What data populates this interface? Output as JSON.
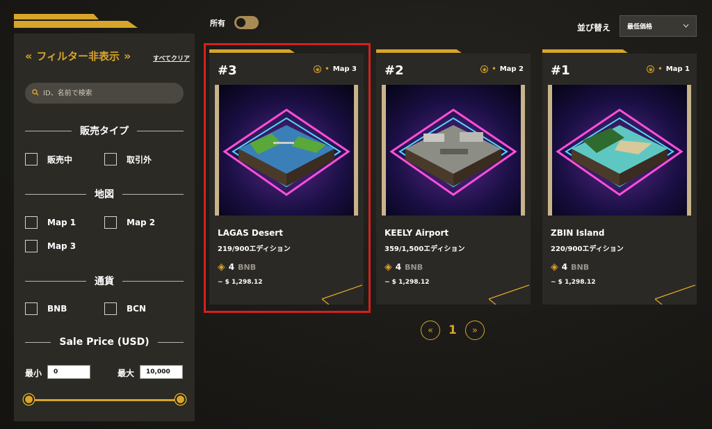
{
  "sidebar": {
    "toggle_left": "«",
    "title": "フィルター非表示",
    "toggle_right": "»",
    "clear_all": "すべてクリア",
    "search_placeholder": "ID、名前で検索",
    "sections": {
      "sale_type": {
        "title": "販売タイプ",
        "options": [
          "販売中",
          "取引外"
        ]
      },
      "map": {
        "title": "地図",
        "options": [
          "Map 1",
          "Map 2",
          "Map 3"
        ]
      },
      "currency": {
        "title": "通貨",
        "options": [
          "BNB",
          "BCN"
        ]
      },
      "price": {
        "title": "Sale Price (USD)",
        "min_label": "最小",
        "min_value": "0",
        "max_label": "最大",
        "max_value": "10,000"
      }
    }
  },
  "topbar": {
    "owned_label": "所有",
    "owned_on": false,
    "sort_label": "並び替え",
    "sort_value": "最低価格"
  },
  "cards": [
    {
      "number": "#3",
      "map": "Map 3",
      "name": "LAGAS Desert",
      "edition": "219/900エディション",
      "price_amount": "4",
      "price_currency": "BNB",
      "price_usd": "~ $ 1,298.12",
      "selected": true
    },
    {
      "number": "#2",
      "map": "Map 2",
      "name": "KEELY Airport",
      "edition": "359/1,500エディション",
      "price_amount": "4",
      "price_currency": "BNB",
      "price_usd": "~ $ 1,298.12",
      "selected": false
    },
    {
      "number": "#1",
      "map": "Map 1",
      "name": "ZBIN Island",
      "edition": "220/900エディション",
      "price_amount": "4",
      "price_currency": "BNB",
      "price_usd": "~ $ 1,298.12",
      "selected": false
    }
  ],
  "pagination": {
    "prev": "«",
    "current": "1",
    "next": "»"
  },
  "colors": {
    "accent": "#d7a52a",
    "panel": "#2c2a25",
    "selected_border": "#d6201e"
  }
}
